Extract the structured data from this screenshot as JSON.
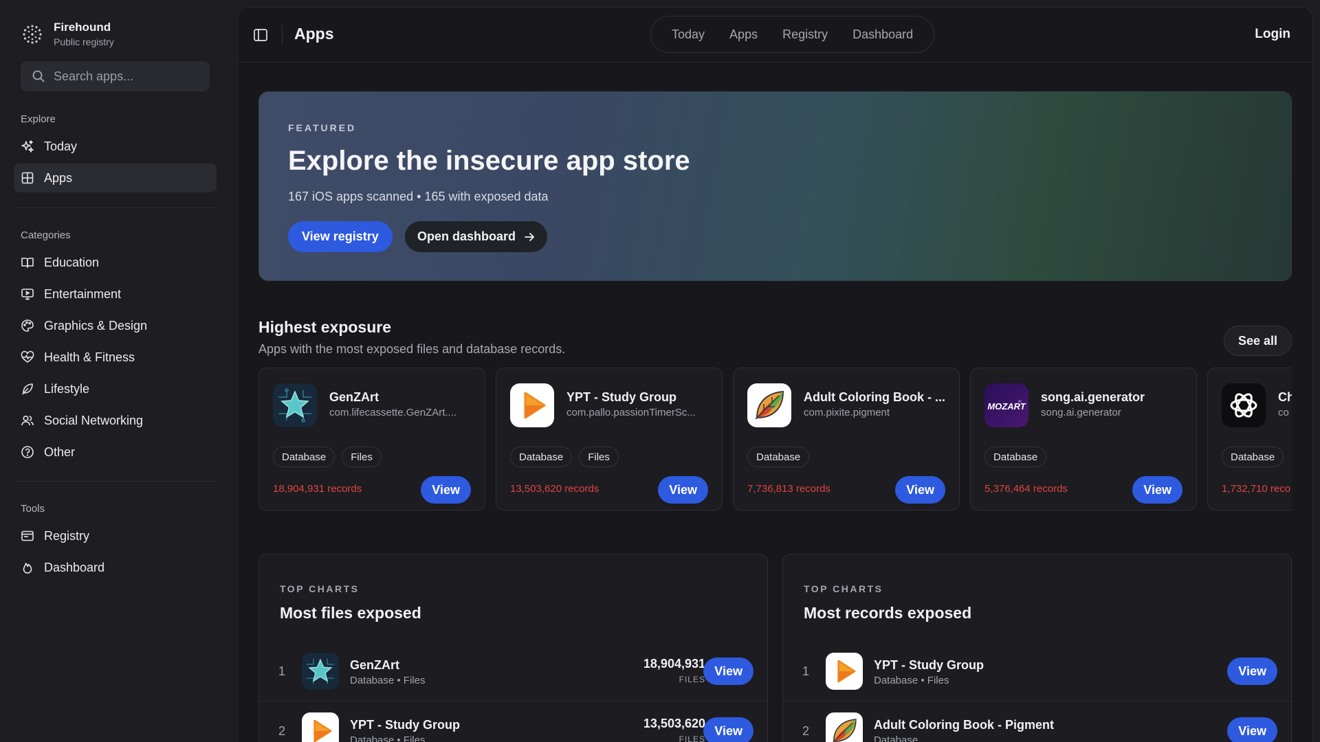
{
  "brand": {
    "name": "Firehound",
    "subtitle": "Public registry"
  },
  "search": {
    "placeholder": "Search apps..."
  },
  "sidebar": {
    "explore_heading": "Explore",
    "explore": [
      {
        "label": "Today",
        "icon": "sparkles-icon"
      },
      {
        "label": "Apps",
        "icon": "grid-icon",
        "active": true
      }
    ],
    "categories_heading": "Categories",
    "categories": [
      {
        "label": "Education",
        "icon": "book-icon"
      },
      {
        "label": "Entertainment",
        "icon": "tv-icon"
      },
      {
        "label": "Graphics & Design",
        "icon": "palette-icon"
      },
      {
        "label": "Health & Fitness",
        "icon": "heart-pulse-icon"
      },
      {
        "label": "Lifestyle",
        "icon": "leaf-icon"
      },
      {
        "label": "Social Networking",
        "icon": "users-icon"
      },
      {
        "label": "Other",
        "icon": "help-circle-icon"
      }
    ],
    "tools_heading": "Tools",
    "tools": [
      {
        "label": "Registry",
        "icon": "browser-window-icon"
      },
      {
        "label": "Dashboard",
        "icon": "flame-icon"
      }
    ]
  },
  "header": {
    "title": "Apps",
    "tabs": [
      "Today",
      "Apps",
      "Registry",
      "Dashboard"
    ],
    "login": "Login"
  },
  "hero": {
    "eyebrow": "FEATURED",
    "title": "Explore the insecure app store",
    "subtitle": "167 iOS apps scanned • 165 with exposed data",
    "primary_button": "View registry",
    "secondary_button": "Open dashboard"
  },
  "highest_exposure": {
    "title": "Highest exposure",
    "subtitle": "Apps with the most exposed files and database records.",
    "see_all": "See all",
    "view_label": "View",
    "cards": [
      {
        "name": "GenZArt",
        "bundle": "com.lifecassette.GenZArt....",
        "tags": [
          "Database",
          "Files"
        ],
        "records": "18,904,931 records",
        "icon": "genzart-icon"
      },
      {
        "name": "YPT - Study Group",
        "bundle": "com.pallo.passionTimerSc...",
        "tags": [
          "Database",
          "Files"
        ],
        "records": "13,503,620 records",
        "icon": "ypt-play-icon"
      },
      {
        "name": "Adult Coloring Book - ...",
        "bundle": "com.pixite.pigment",
        "tags": [
          "Database"
        ],
        "records": "7,736,813 records",
        "icon": "pigment-leaf-icon"
      },
      {
        "name": "song.ai.generator",
        "bundle": "song.ai.generator",
        "tags": [
          "Database"
        ],
        "records": "5,376,464 records",
        "icon": "mozart-icon"
      },
      {
        "name": "Ch",
        "bundle": "co",
        "tags": [
          "Database"
        ],
        "records": "1,732,710 reco",
        "icon": "chatgpt-knot-icon"
      }
    ]
  },
  "top_files": {
    "eyebrow": "TOP CHARTS",
    "title": "Most files exposed",
    "rows": [
      {
        "rank": "1",
        "name": "GenZArt",
        "meta": "Database • Files",
        "count": "18,904,931",
        "unit": "FILES",
        "view": "View",
        "icon": "genzart-icon"
      },
      {
        "rank": "2",
        "name": "YPT - Study Group",
        "meta": "Database • Files",
        "count": "13,503,620",
        "unit": "FILES",
        "view": "View",
        "icon": "ypt-play-icon"
      }
    ]
  },
  "top_records": {
    "eyebrow": "TOP CHARTS",
    "title": "Most records exposed",
    "rows": [
      {
        "rank": "1",
        "name": "YPT - Study Group",
        "meta": "Database • Files",
        "view": "View",
        "icon": "ypt-play-icon"
      },
      {
        "rank": "2",
        "name": "Adult Coloring Book - Pigment",
        "meta": "Database",
        "view": "View",
        "icon": "pigment-leaf-icon"
      }
    ]
  },
  "colors": {
    "accent": "#2e5ae0",
    "records_red": "#e0453f",
    "background": "#18181c",
    "sidebar": "#1d1d22"
  }
}
